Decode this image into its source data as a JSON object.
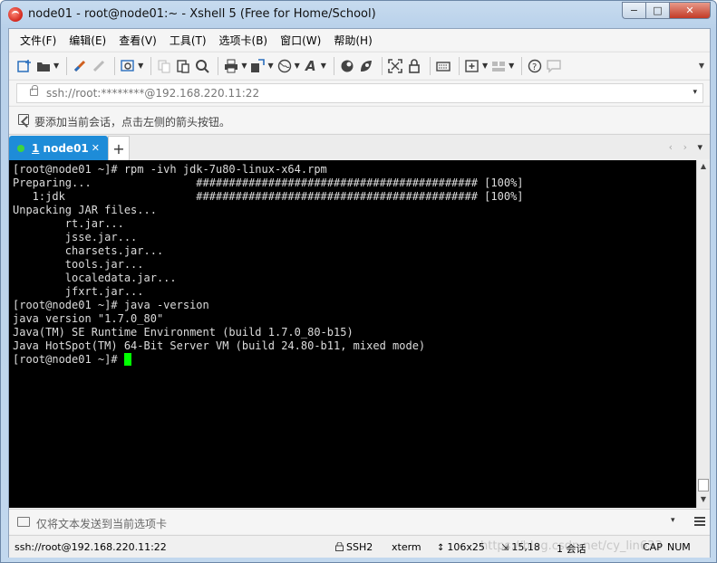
{
  "window": {
    "title": "node01 - root@node01:~ - Xshell 5 (Free for Home/School)",
    "buttons": {
      "minimize": "−",
      "maximize": "□",
      "close": "✕"
    }
  },
  "menu": [
    "文件(F)",
    "编辑(E)",
    "查看(V)",
    "工具(T)",
    "选项卡(B)",
    "窗口(W)",
    "帮助(H)"
  ],
  "address": {
    "value": "ssh://root:********@192.168.220.11:22",
    "dropdown": "▾"
  },
  "hint": "要添加当前会话，点击左侧的箭头按钮。",
  "tab": {
    "number": "1",
    "label": "node01",
    "close": "✕",
    "add": "+",
    "nav": "‹ ›",
    "nav_menu": "▾"
  },
  "terminal": {
    "lines": [
      "[root@node01 ~]# rpm -ivh jdk-7u80-linux-x64.rpm",
      "Preparing...                ########################################### [100%]",
      "   1:jdk                    ########################################### [100%]",
      "Unpacking JAR files...",
      "        rt.jar...",
      "        jsse.jar...",
      "        charsets.jar...",
      "        tools.jar...",
      "        localedata.jar...",
      "        jfxrt.jar...",
      "[root@node01 ~]# java -version",
      "java version \"1.7.0_80\"",
      "Java(TM) SE Runtime Environment (build 1.7.0_80-b15)",
      "Java HotSpot(TM) 64-Bit Server VM (build 24.80-b11, mixed mode)"
    ],
    "prompt": "[root@node01 ~]# ",
    "cursor_color": "#00ff00"
  },
  "compose": {
    "placeholder": "仅将文本发送到当前选项卡",
    "dropdown": "▾"
  },
  "status": {
    "connection": "ssh://root@192.168.220.11:22",
    "protocol": "SSH2",
    "terminal_type": "xterm",
    "size": "106x25",
    "cursor_pos": "15,18",
    "sessions": "1 会话",
    "caps": "CAP",
    "num": "NUM",
    "watermark": "https://blog.csdn.net/cy_lin633"
  },
  "colors": {
    "tab_active": "#1e8cd8",
    "terminal_bg": "#000000",
    "terminal_fg": "#dcdcdc"
  }
}
